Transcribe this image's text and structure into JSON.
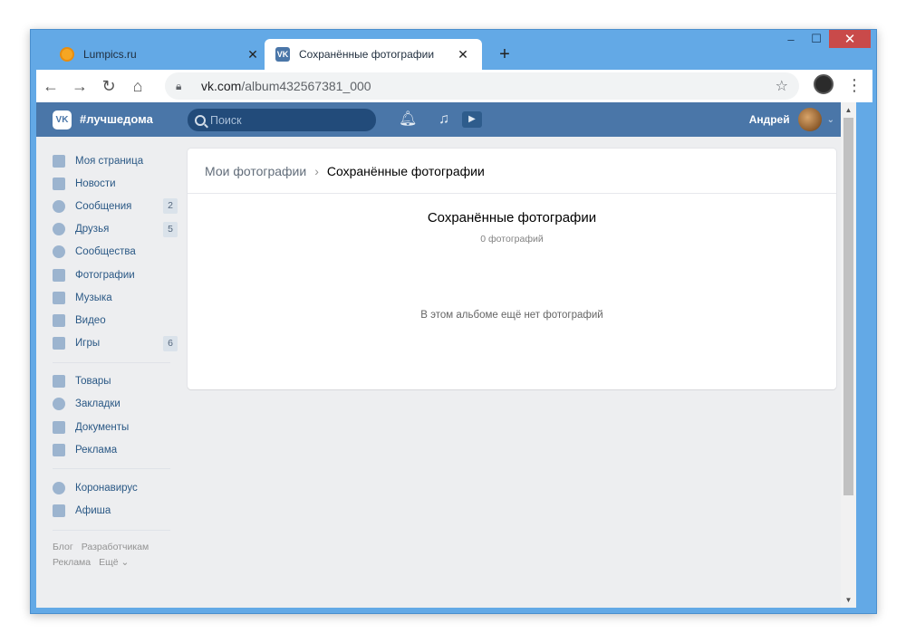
{
  "window": {
    "controls": {
      "minimize": "–",
      "maximize": "☐",
      "close": "✕"
    }
  },
  "tabs": [
    {
      "title": "Lumpics.ru",
      "favicon": "orange-circle-icon",
      "close": "✕",
      "active": false
    },
    {
      "title": "Сохранённые фотографии",
      "favicon": "vk-icon",
      "close": "✕",
      "active": true
    }
  ],
  "newtab": "+",
  "toolbar": {
    "back": "←",
    "forward": "→",
    "reload": "↻",
    "home": "⌂",
    "url_host": "vk.com",
    "url_path": "/album432567381_000",
    "lock": "🔒",
    "bookmark": "☆",
    "menu": "⋮"
  },
  "vk": {
    "logo": "VK",
    "brand": "#лучшедома",
    "search_placeholder": "Поиск",
    "user_name": "Андрей",
    "header_icons": {
      "bell": "🔔",
      "music": "♫",
      "video": "▶"
    },
    "menu": [
      {
        "label": "Моя страница",
        "icon": "home-icon",
        "badge": ""
      },
      {
        "label": "Новости",
        "icon": "news-icon",
        "badge": ""
      },
      {
        "label": "Сообщения",
        "icon": "messages-icon",
        "badge": "2"
      },
      {
        "label": "Друзья",
        "icon": "friends-icon",
        "badge": "5"
      },
      {
        "label": "Сообщества",
        "icon": "groups-icon",
        "badge": ""
      },
      {
        "label": "Фотографии",
        "icon": "camera-icon",
        "badge": ""
      },
      {
        "label": "Музыка",
        "icon": "music-icon",
        "badge": ""
      },
      {
        "label": "Видео",
        "icon": "video-icon",
        "badge": ""
      },
      {
        "label": "Игры",
        "icon": "games-icon",
        "badge": "6"
      }
    ],
    "menu2": [
      {
        "label": "Товары",
        "icon": "bag-icon"
      },
      {
        "label": "Закладки",
        "icon": "star-icon"
      },
      {
        "label": "Документы",
        "icon": "document-icon"
      },
      {
        "label": "Реклама",
        "icon": "megaphone-icon"
      }
    ],
    "menu3": [
      {
        "label": "Коронавирус",
        "icon": "virus-icon"
      },
      {
        "label": "Афиша",
        "icon": "play-circle-icon"
      }
    ],
    "footer": {
      "blog": "Блог",
      "developers": "Разработчикам",
      "ads": "Реклама",
      "more": "Ещё ⌄"
    },
    "breadcrumb": {
      "parent": "Мои фотографии",
      "current": "Сохранённые фотографии"
    },
    "album": {
      "title": "Сохранённые фотографии",
      "count": "0 фотографий",
      "empty": "В этом альбоме ещё нет фотографий"
    }
  }
}
